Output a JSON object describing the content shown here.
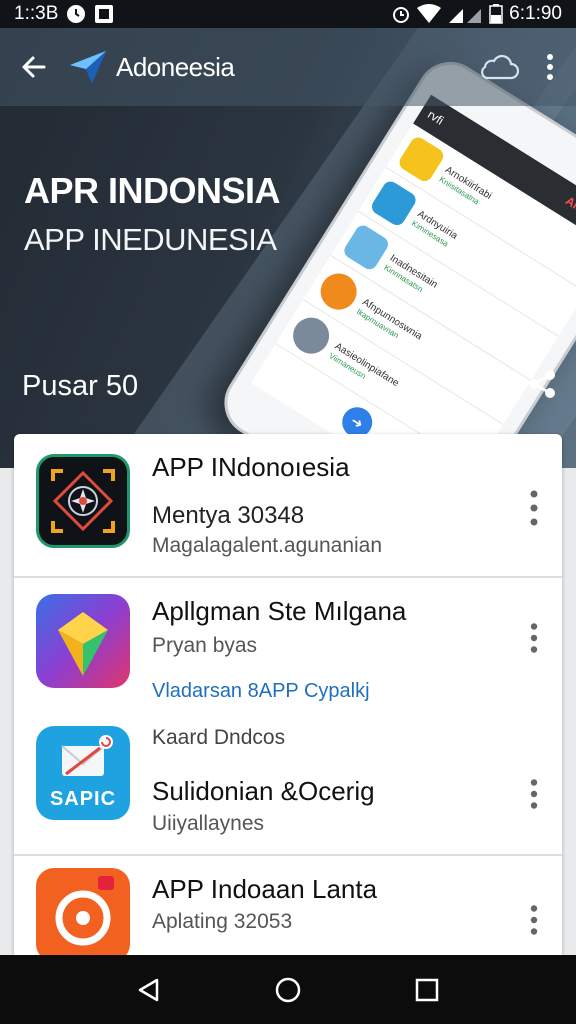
{
  "status_bar": {
    "time_left": "1::3B",
    "time_right": "6:1:90"
  },
  "app_bar": {
    "title": "Adoneesia"
  },
  "hero": {
    "title": "APR INDONSIA",
    "subtitle": "APP INEDUNESIA",
    "count_label": "Pusar 50"
  },
  "phone_mockup": {
    "header_label": "Aindnesia",
    "header_left": "rvfi",
    "rows": [
      {
        "title": "Arnokiirlrabi",
        "sub": "Kniisitasatna"
      },
      {
        "title": "Ardnyuiria",
        "sub": "Kiminesasa"
      },
      {
        "title": "Inadnesitain",
        "sub": "Kinnnasatsn"
      },
      {
        "title": "Afnpunnoswnia",
        "sub": "Ikapmuavnan"
      },
      {
        "title": "Aasieolinpiafane",
        "sub": "Viimaneusn"
      }
    ]
  },
  "apps": [
    {
      "title": "APP INdonoıesia",
      "line1": "Mentya 30348",
      "line2": "Magalagalent.agunanian",
      "icon": "compass-star-icon"
    },
    {
      "title": "Apllgman Ste Mılgana",
      "line1": "Pryan byas",
      "link": "Vladarsan 8APP Cypalkj",
      "icon": "folded-pin-icon"
    },
    {
      "pre": "Kaard Dndcos",
      "title": "Sulidonian &Ocerig",
      "line1": "Uiiyallaynes",
      "icon_text": "SAPIC",
      "icon": "sapic-icon"
    },
    {
      "title": "APP Indoaan Lanta",
      "line1": "Aplating 32053",
      "icon": "target-icon"
    }
  ],
  "colors": {
    "hero_dark": "#222a33",
    "link": "#1f6fbf",
    "sapic_blue": "#1fa3e0",
    "target_orange": "#f2611f"
  }
}
